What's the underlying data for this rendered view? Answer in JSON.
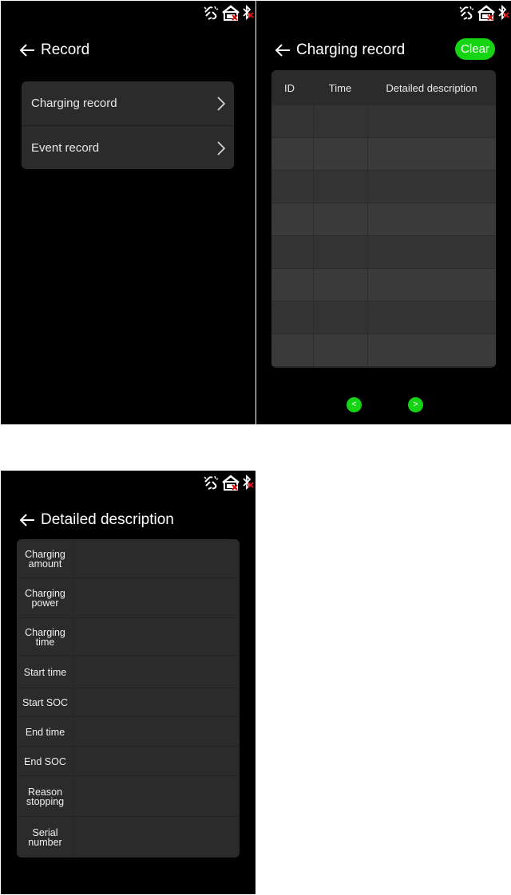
{
  "screen_record": {
    "title": "Record",
    "menu": [
      {
        "label": "Charging record"
      },
      {
        "label": "Event record"
      }
    ]
  },
  "screen_charging_record": {
    "title": "Charging record",
    "clear_label": "Clear",
    "columns": [
      "ID",
      "Time",
      "Detailed description"
    ],
    "row_count": 8,
    "prev_label": "<",
    "next_label": ">"
  },
  "screen_detail": {
    "title": "Detailed description",
    "rows": [
      {
        "label": "Charging amount"
      },
      {
        "label": "Charging power"
      },
      {
        "label": "Charging time"
      },
      {
        "label": "Start time"
      },
      {
        "label": "Start SOC"
      },
      {
        "label": "End time"
      },
      {
        "label": "End SOC"
      },
      {
        "label": "Reason stopping"
      },
      {
        "label": "Serial number"
      }
    ]
  },
  "status_icons": [
    "network-disconnected-icon",
    "router-error-icon",
    "bluetooth-off-icon"
  ],
  "colors": {
    "accent": "#14d414",
    "panel": "#2b2b2b",
    "background": "#000000",
    "error": "#e01010"
  }
}
